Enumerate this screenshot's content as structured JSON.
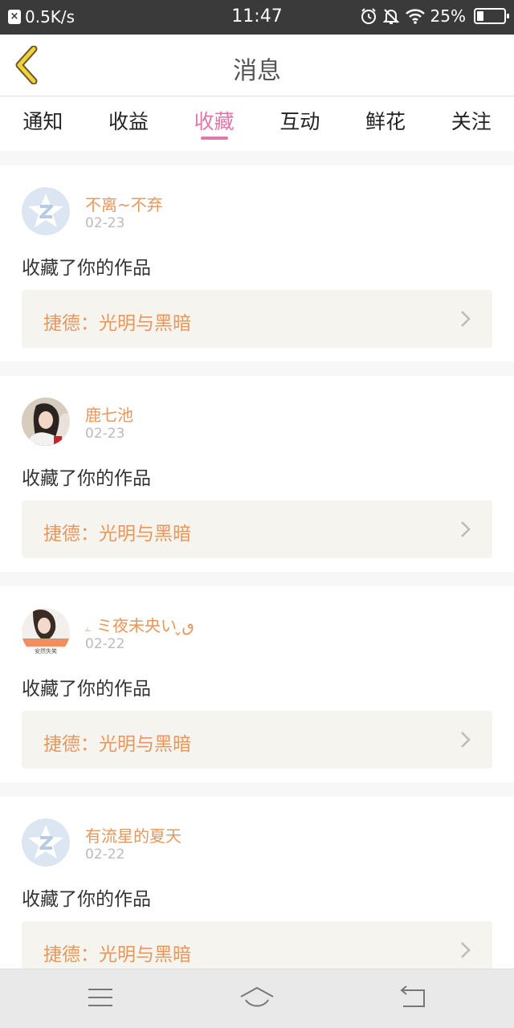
{
  "status_bar": {
    "speed": "0.5K/s",
    "time": "11:47",
    "battery": "25%",
    "battery_level": 0.25,
    "icons": [
      "notification-x-icon",
      "alarm-icon",
      "bell-off-icon",
      "wifi-icon",
      "battery-icon"
    ]
  },
  "header": {
    "title": "消息",
    "back_icon": "chevron-left-icon"
  },
  "tabs": [
    {
      "label": "通知",
      "active": false
    },
    {
      "label": "收益",
      "active": false
    },
    {
      "label": "收藏",
      "active": true
    },
    {
      "label": "互动",
      "active": false
    },
    {
      "label": "鲜花",
      "active": false
    },
    {
      "label": "关注",
      "active": false
    }
  ],
  "items": [
    {
      "user": "不离~不弃",
      "date": "02-23",
      "action": "收藏了你的作品",
      "work": "捷德：光明与黑暗",
      "avatar": "qq-default-avatar"
    },
    {
      "user": "鹿七池",
      "date": "02-23",
      "action": "收藏了你的作品",
      "work": "捷德：光明与黑暗",
      "avatar": "photo-avatar-girl"
    },
    {
      "user": "ۦ ミ夜未央い ̬ٯ",
      "date": "02-22",
      "action": "收藏了你的作品",
      "work": "捷德：光明与黑暗",
      "avatar": "photo-avatar-sticker"
    },
    {
      "user": "有流星的夏天",
      "date": "02-22",
      "action": "收藏了你的作品",
      "work": "捷德：光明与黑暗",
      "avatar": "qq-default-avatar"
    }
  ],
  "avatar_sticker_text": "安然失笑",
  "colors": {
    "accent": "#e377a9",
    "name": "#e8975c",
    "work_bg": "#f6f4ef",
    "status_bar": "#3a3a3a"
  },
  "nav": {
    "icons": [
      "menu-icon",
      "home-icon",
      "back-icon"
    ]
  }
}
